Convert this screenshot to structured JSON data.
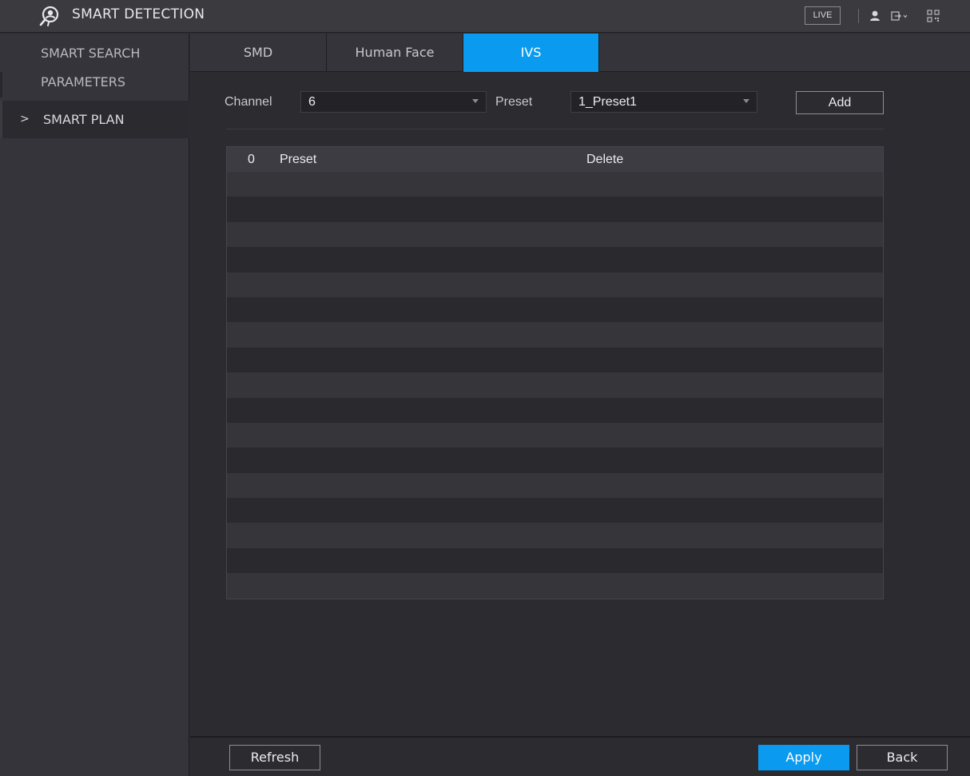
{
  "app": {
    "title": "SMART DETECTION",
    "live_label": "LIVE",
    "icons": [
      "smart-detection-logo-icon",
      "user-icon",
      "logout-icon",
      "qr-code-icon"
    ]
  },
  "sidebar": {
    "items": [
      {
        "label": "SMART SEARCH",
        "active": false
      },
      {
        "label": "PARAMETERS",
        "active": false
      },
      {
        "label": "SMART PLAN",
        "active": true
      }
    ],
    "active_marker": ">"
  },
  "tabs": [
    {
      "label": "SMD",
      "active": false
    },
    {
      "label": "Human Face",
      "active": false
    },
    {
      "label": "IVS",
      "active": true
    }
  ],
  "form": {
    "channel_label": "Channel",
    "channel_value": "6",
    "preset_label": "Preset",
    "preset_value": "1_Preset1",
    "add_label": "Add"
  },
  "table": {
    "headers": {
      "count": "0",
      "preset": "Preset",
      "delete": "Delete"
    },
    "rows": []
  },
  "footer": {
    "refresh_label": "Refresh",
    "apply_label": "Apply",
    "back_label": "Back"
  },
  "colors": {
    "accent": "#0a9bf0",
    "background": "#2b2b30",
    "panel": "#34343a"
  }
}
